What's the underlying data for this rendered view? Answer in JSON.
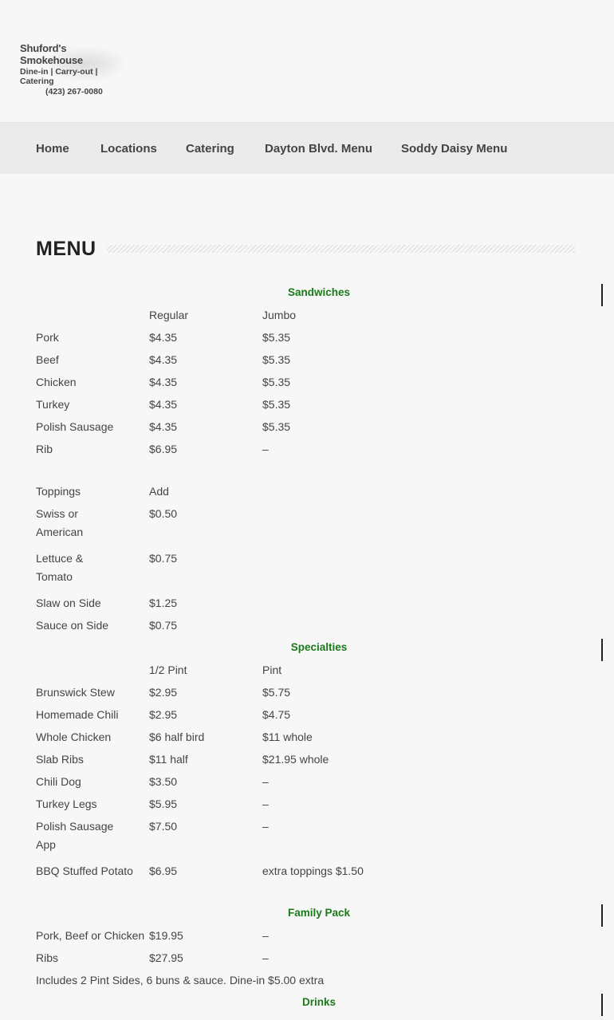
{
  "logo": {
    "name": "Shuford's Smokehouse",
    "services": "Dine-in | Carry-out | Catering",
    "phone": "(423) 267-0080"
  },
  "nav": {
    "items": [
      "Home",
      "Locations",
      "Catering",
      "Dayton Blvd. Menu",
      "Soddy Daisy Menu"
    ]
  },
  "page": {
    "title": "MENU"
  },
  "sections": {
    "sandwiches": {
      "title": "Sandwiches",
      "header": [
        "",
        "Regular",
        "Jumbo"
      ],
      "rows": [
        [
          "Pork",
          "$4.35",
          "$5.35"
        ],
        [
          "Beef",
          "$4.35",
          "$5.35"
        ],
        [
          "Chicken",
          "$4.35",
          "$5.35"
        ],
        [
          "Turkey",
          "$4.35",
          "$5.35"
        ],
        [
          "Polish Sausage",
          "$4.35",
          "$5.35"
        ],
        [
          "Rib",
          "$6.95",
          "–"
        ]
      ]
    },
    "toppings": {
      "header": [
        "Toppings",
        "Add"
      ],
      "rows": [
        [
          "Swiss or American",
          "$0.50"
        ],
        [
          "Lettuce & Tomato",
          "$0.75"
        ],
        [
          "Slaw on Side",
          "$1.25"
        ],
        [
          "Sauce on Side",
          "$0.75"
        ]
      ]
    },
    "specialties": {
      "title": "Specialties",
      "header": [
        "",
        "1/2 Pint",
        "Pint"
      ],
      "rows": [
        [
          "Brunswick Stew",
          "$2.95",
          "$5.75"
        ],
        [
          "Homemade Chili",
          "$2.95",
          "$4.75"
        ],
        [
          "Whole Chicken",
          "$6 half bird",
          "$11 whole"
        ],
        [
          "Slab Ribs",
          "$11 half",
          "$21.95 whole"
        ],
        [
          "Chili Dog",
          "$3.50",
          "–"
        ],
        [
          "Turkey Legs",
          "$5.95",
          "–"
        ],
        [
          "Polish Sausage App",
          "$7.50",
          "–"
        ],
        [
          "BBQ Stuffed Potato",
          "$6.95",
          "extra toppings $1.50"
        ]
      ]
    },
    "family_pack": {
      "title": "Family Pack",
      "rows": [
        [
          "Pork, Beef or Chicken",
          "$19.95",
          "–"
        ],
        [
          "Ribs",
          "$27.95",
          "–"
        ]
      ],
      "note": "Includes 2 Pint Sides, 6 buns & sauce. Dine-in $5.00 extra"
    },
    "drinks": {
      "title": "Drinks"
    }
  }
}
